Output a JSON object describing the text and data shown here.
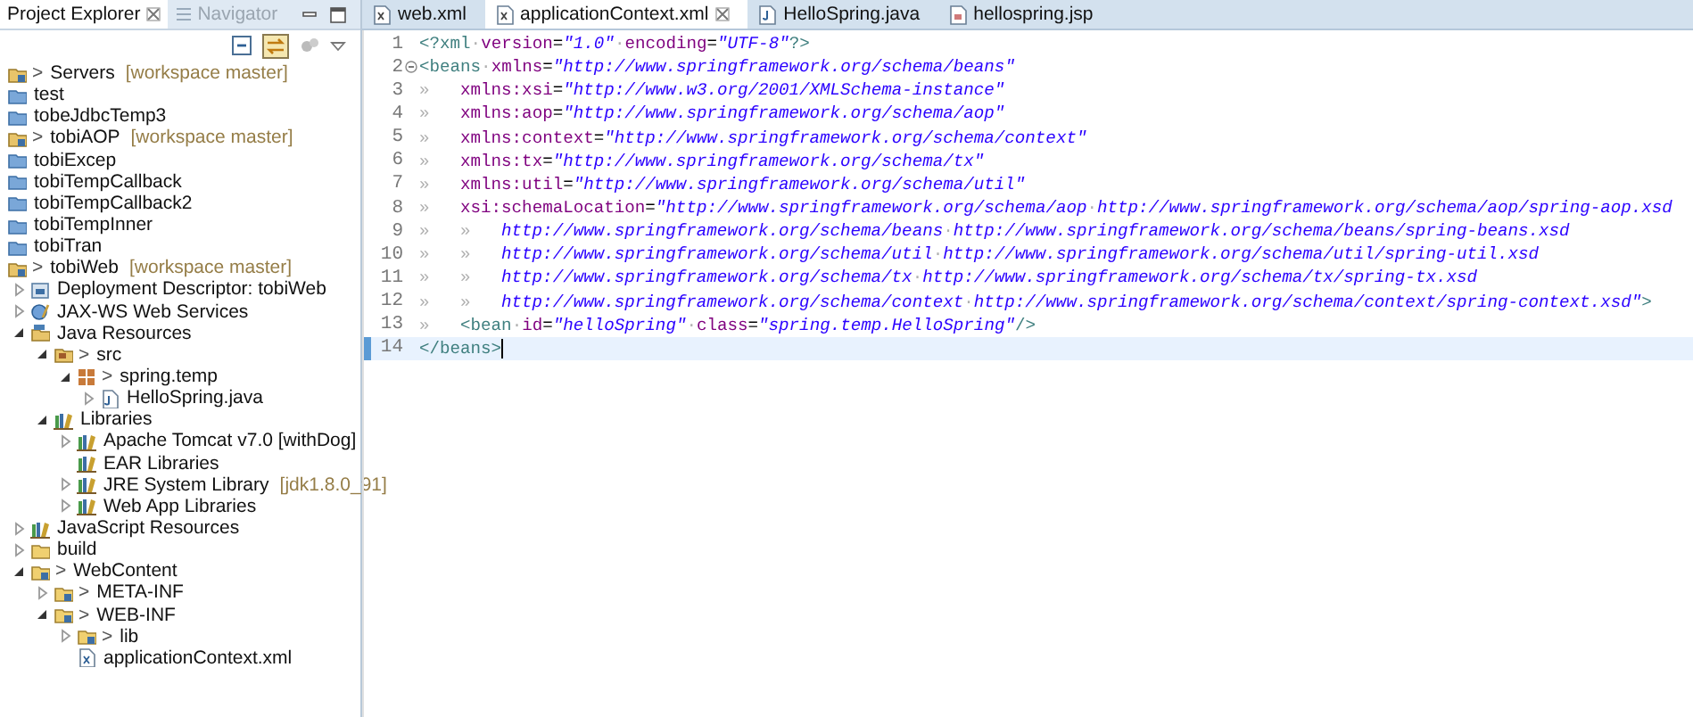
{
  "explorer": {
    "tabs": [
      {
        "label": "Project Explorer",
        "selected": true
      },
      {
        "label": "Navigator",
        "selected": false
      }
    ],
    "tree": [
      {
        "kind": "git_project",
        "marker": ">",
        "label": "Servers",
        "decoration": "[workspace master]"
      },
      {
        "kind": "project",
        "label": "test"
      },
      {
        "kind": "project",
        "label": "tobeJdbcTemp3"
      },
      {
        "kind": "git_project",
        "marker": ">",
        "label": "tobiAOP",
        "decoration": "[workspace master]"
      },
      {
        "kind": "project",
        "label": "tobiExcep"
      },
      {
        "kind": "project",
        "label": "tobiTempCallback"
      },
      {
        "kind": "project",
        "label": "tobiTempCallback2"
      },
      {
        "kind": "project",
        "label": "tobiTempInner"
      },
      {
        "kind": "project",
        "label": "tobiTran"
      },
      {
        "kind": "git_project",
        "marker": ">",
        "label": "tobiWeb",
        "decoration": "[workspace master]",
        "children": [
          {
            "kind": "descriptor",
            "label": "Deployment Descriptor: tobiWeb",
            "expanded": false
          },
          {
            "kind": "webservice",
            "label": "JAX-WS Web Services",
            "expanded": false
          },
          {
            "kind": "resources",
            "label": "Java Resources",
            "expanded": true,
            "children": [
              {
                "kind": "src_folder",
                "marker": ">",
                "label": "src",
                "expanded": true,
                "children": [
                  {
                    "kind": "package",
                    "marker": ">",
                    "label": "spring.temp",
                    "expanded": true,
                    "children": [
                      {
                        "kind": "java_file",
                        "label": "HelloSpring.java",
                        "expanded": false
                      }
                    ]
                  }
                ]
              },
              {
                "kind": "library",
                "label": "Libraries",
                "expanded": true,
                "children": [
                  {
                    "kind": "library",
                    "label": "Apache Tomcat v7.0 [withDog]",
                    "expanded": false
                  },
                  {
                    "kind": "library",
                    "label": "EAR Libraries"
                  },
                  {
                    "kind": "library",
                    "label": "JRE System Library",
                    "decoration": "[jdk1.8.0_91]",
                    "expanded": false
                  },
                  {
                    "kind": "library",
                    "label": "Web App Libraries",
                    "expanded": false
                  }
                ]
              }
            ]
          },
          {
            "kind": "library",
            "label": "JavaScript Resources",
            "expanded": false
          },
          {
            "kind": "folder",
            "label": "build",
            "expanded": false
          },
          {
            "kind": "git_folder",
            "marker": ">",
            "label": "WebContent",
            "expanded": true,
            "children": [
              {
                "kind": "git_folder",
                "marker": ">",
                "label": "META-INF",
                "expanded": false
              },
              {
                "kind": "git_folder",
                "marker": ">",
                "label": "WEB-INF",
                "expanded": true,
                "children": [
                  {
                    "kind": "git_folder",
                    "marker": ">",
                    "label": "lib",
                    "expanded": false
                  },
                  {
                    "kind": "xml_file",
                    "label": "applicationContext.xml"
                  }
                ]
              }
            ]
          }
        ]
      }
    ]
  },
  "editor": {
    "tabs": [
      {
        "label": "web.xml",
        "kind": "xml",
        "selected": false
      },
      {
        "label": "applicationContext.xml",
        "kind": "xml",
        "selected": true
      },
      {
        "label": "HelloSpring.java",
        "kind": "java",
        "selected": false
      },
      {
        "label": "hellospring.jsp",
        "kind": "jsp",
        "selected": false
      }
    ],
    "lines": [
      {
        "number": "1",
        "current": false,
        "segments": [
          {
            "kind": "tag",
            "text": "<?xml"
          },
          {
            "kind": "ws",
            "text": "·"
          },
          {
            "kind": "attr",
            "text": "version"
          },
          {
            "kind": "plain",
            "text": "="
          },
          {
            "kind": "value",
            "text": "\"1.0\""
          },
          {
            "kind": "ws",
            "text": "·"
          },
          {
            "kind": "attr",
            "text": "encoding"
          },
          {
            "kind": "plain",
            "text": "="
          },
          {
            "kind": "value",
            "text": "\"UTF-8\""
          },
          {
            "kind": "tag",
            "text": "?>"
          }
        ]
      },
      {
        "number": "2",
        "fold": true,
        "current": false,
        "segments": [
          {
            "kind": "tag",
            "text": "<beans"
          },
          {
            "kind": "ws",
            "text": "·"
          },
          {
            "kind": "attr",
            "text": "xmlns"
          },
          {
            "kind": "plain",
            "text": "="
          },
          {
            "kind": "value",
            "text": "\"http://www.springframework.org/schema/beans\""
          }
        ]
      },
      {
        "number": "3",
        "current": false,
        "segments": [
          {
            "kind": "tab",
            "text": "»"
          },
          {
            "kind": "attr",
            "text": "xmlns:xsi"
          },
          {
            "kind": "plain",
            "text": "="
          },
          {
            "kind": "value",
            "text": "\"http://www.w3.org/2001/XMLSchema-instance\""
          }
        ]
      },
      {
        "number": "4",
        "current": false,
        "segments": [
          {
            "kind": "tab",
            "text": "»"
          },
          {
            "kind": "attr",
            "text": "xmlns:aop"
          },
          {
            "kind": "plain",
            "text": "="
          },
          {
            "kind": "value",
            "text": "\"http://www.springframework.org/schema/aop\""
          }
        ]
      },
      {
        "number": "5",
        "current": false,
        "segments": [
          {
            "kind": "tab",
            "text": "»"
          },
          {
            "kind": "attr",
            "text": "xmlns:context"
          },
          {
            "kind": "plain",
            "text": "="
          },
          {
            "kind": "value",
            "text": "\"http://www.springframework.org/schema/context\""
          }
        ]
      },
      {
        "number": "6",
        "current": false,
        "segments": [
          {
            "kind": "tab",
            "text": "»"
          },
          {
            "kind": "attr",
            "text": "xmlns:tx"
          },
          {
            "kind": "plain",
            "text": "="
          },
          {
            "kind": "value",
            "text": "\"http://www.springframework.org/schema/tx\""
          }
        ]
      },
      {
        "number": "7",
        "current": false,
        "segments": [
          {
            "kind": "tab",
            "text": "»"
          },
          {
            "kind": "attr",
            "text": "xmlns:util"
          },
          {
            "kind": "plain",
            "text": "="
          },
          {
            "kind": "value",
            "text": "\"http://www.springframework.org/schema/util\""
          }
        ]
      },
      {
        "number": "8",
        "current": false,
        "segments": [
          {
            "kind": "tab",
            "text": "»"
          },
          {
            "kind": "attr",
            "text": "xsi:schemaLocation"
          },
          {
            "kind": "plain",
            "text": "="
          },
          {
            "kind": "value",
            "text": "\"http://www.springframework.org/schema/aop"
          },
          {
            "kind": "ws",
            "text": "·"
          },
          {
            "kind": "value",
            "text": "http://www.springframework.org/schema/aop/spring-aop.xsd"
          }
        ]
      },
      {
        "number": "9",
        "current": false,
        "segments": [
          {
            "kind": "tab",
            "text": "»"
          },
          {
            "kind": "tab",
            "text": "»"
          },
          {
            "kind": "value",
            "text": "http://www.springframework.org/schema/beans"
          },
          {
            "kind": "ws",
            "text": "·"
          },
          {
            "kind": "value",
            "text": "http://www.springframework.org/schema/beans/spring-beans.xsd"
          }
        ]
      },
      {
        "number": "10",
        "current": false,
        "segments": [
          {
            "kind": "tab",
            "text": "»"
          },
          {
            "kind": "tab",
            "text": "»"
          },
          {
            "kind": "value",
            "text": "http://www.springframework.org/schema/util"
          },
          {
            "kind": "ws",
            "text": "·"
          },
          {
            "kind": "value",
            "text": "http://www.springframework.org/schema/util/spring-util.xsd"
          }
        ]
      },
      {
        "number": "11",
        "current": false,
        "segments": [
          {
            "kind": "tab",
            "text": "»"
          },
          {
            "kind": "tab",
            "text": "»"
          },
          {
            "kind": "value",
            "text": "http://www.springframework.org/schema/tx"
          },
          {
            "kind": "ws",
            "text": "·"
          },
          {
            "kind": "value",
            "text": "http://www.springframework.org/schema/tx/spring-tx.xsd"
          }
        ]
      },
      {
        "number": "12",
        "current": false,
        "segments": [
          {
            "kind": "tab",
            "text": "»"
          },
          {
            "kind": "tab",
            "text": "»"
          },
          {
            "kind": "value",
            "text": "http://www.springframework.org/schema/context"
          },
          {
            "kind": "ws",
            "text": "·"
          },
          {
            "kind": "value",
            "text": "http://www.springframework.org/schema/context/spring-context.xsd\""
          },
          {
            "kind": "tag",
            "text": ">"
          }
        ]
      },
      {
        "number": "13",
        "current": false,
        "segments": [
          {
            "kind": "tab",
            "text": "»"
          },
          {
            "kind": "tag",
            "text": "<bean"
          },
          {
            "kind": "ws",
            "text": "·"
          },
          {
            "kind": "attr",
            "text": "id"
          },
          {
            "kind": "plain",
            "text": "="
          },
          {
            "kind": "value",
            "text": "\"helloSpring\""
          },
          {
            "kind": "ws",
            "text": "·"
          },
          {
            "kind": "attr",
            "text": "class"
          },
          {
            "kind": "plain",
            "text": "="
          },
          {
            "kind": "value",
            "text": "\"spring.temp.HelloSpring\""
          },
          {
            "kind": "tag",
            "text": "/>"
          }
        ]
      },
      {
        "number": "14",
        "current": true,
        "segments": [
          {
            "kind": "tag",
            "text": "</beans>"
          }
        ]
      }
    ]
  }
}
